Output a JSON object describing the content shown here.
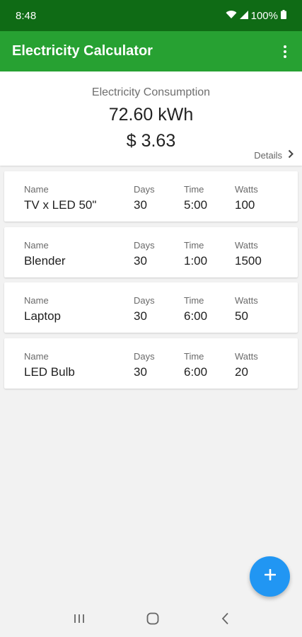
{
  "status_bar": {
    "time": "8:48",
    "battery": "100%"
  },
  "app_bar": {
    "title": "Electricity Calculator"
  },
  "summary": {
    "label": "Electricity Consumption",
    "kwh": "72.60 kWh",
    "cost": "$ 3.63",
    "details_label": "Details"
  },
  "labels": {
    "name": "Name",
    "days": "Days",
    "time": "Time",
    "watts": "Watts"
  },
  "appliances": [
    {
      "name": "TV x LED 50\"",
      "days": "30",
      "time": "5:00",
      "watts": "100"
    },
    {
      "name": "Blender",
      "days": "30",
      "time": "1:00",
      "watts": "1500"
    },
    {
      "name": "Laptop",
      "days": "30",
      "time": "6:00",
      "watts": "50"
    },
    {
      "name": "LED Bulb",
      "days": "30",
      "time": "6:00",
      "watts": "20"
    }
  ],
  "colors": {
    "status_bar": "#0f6b15",
    "app_bar": "#27a132",
    "fab": "#2196f3"
  },
  "icons": [
    "wifi-icon",
    "signal-icon",
    "battery-icon",
    "more-vert-icon",
    "chevron-right-icon",
    "add-icon",
    "recents-icon",
    "home-icon",
    "back-icon"
  ]
}
